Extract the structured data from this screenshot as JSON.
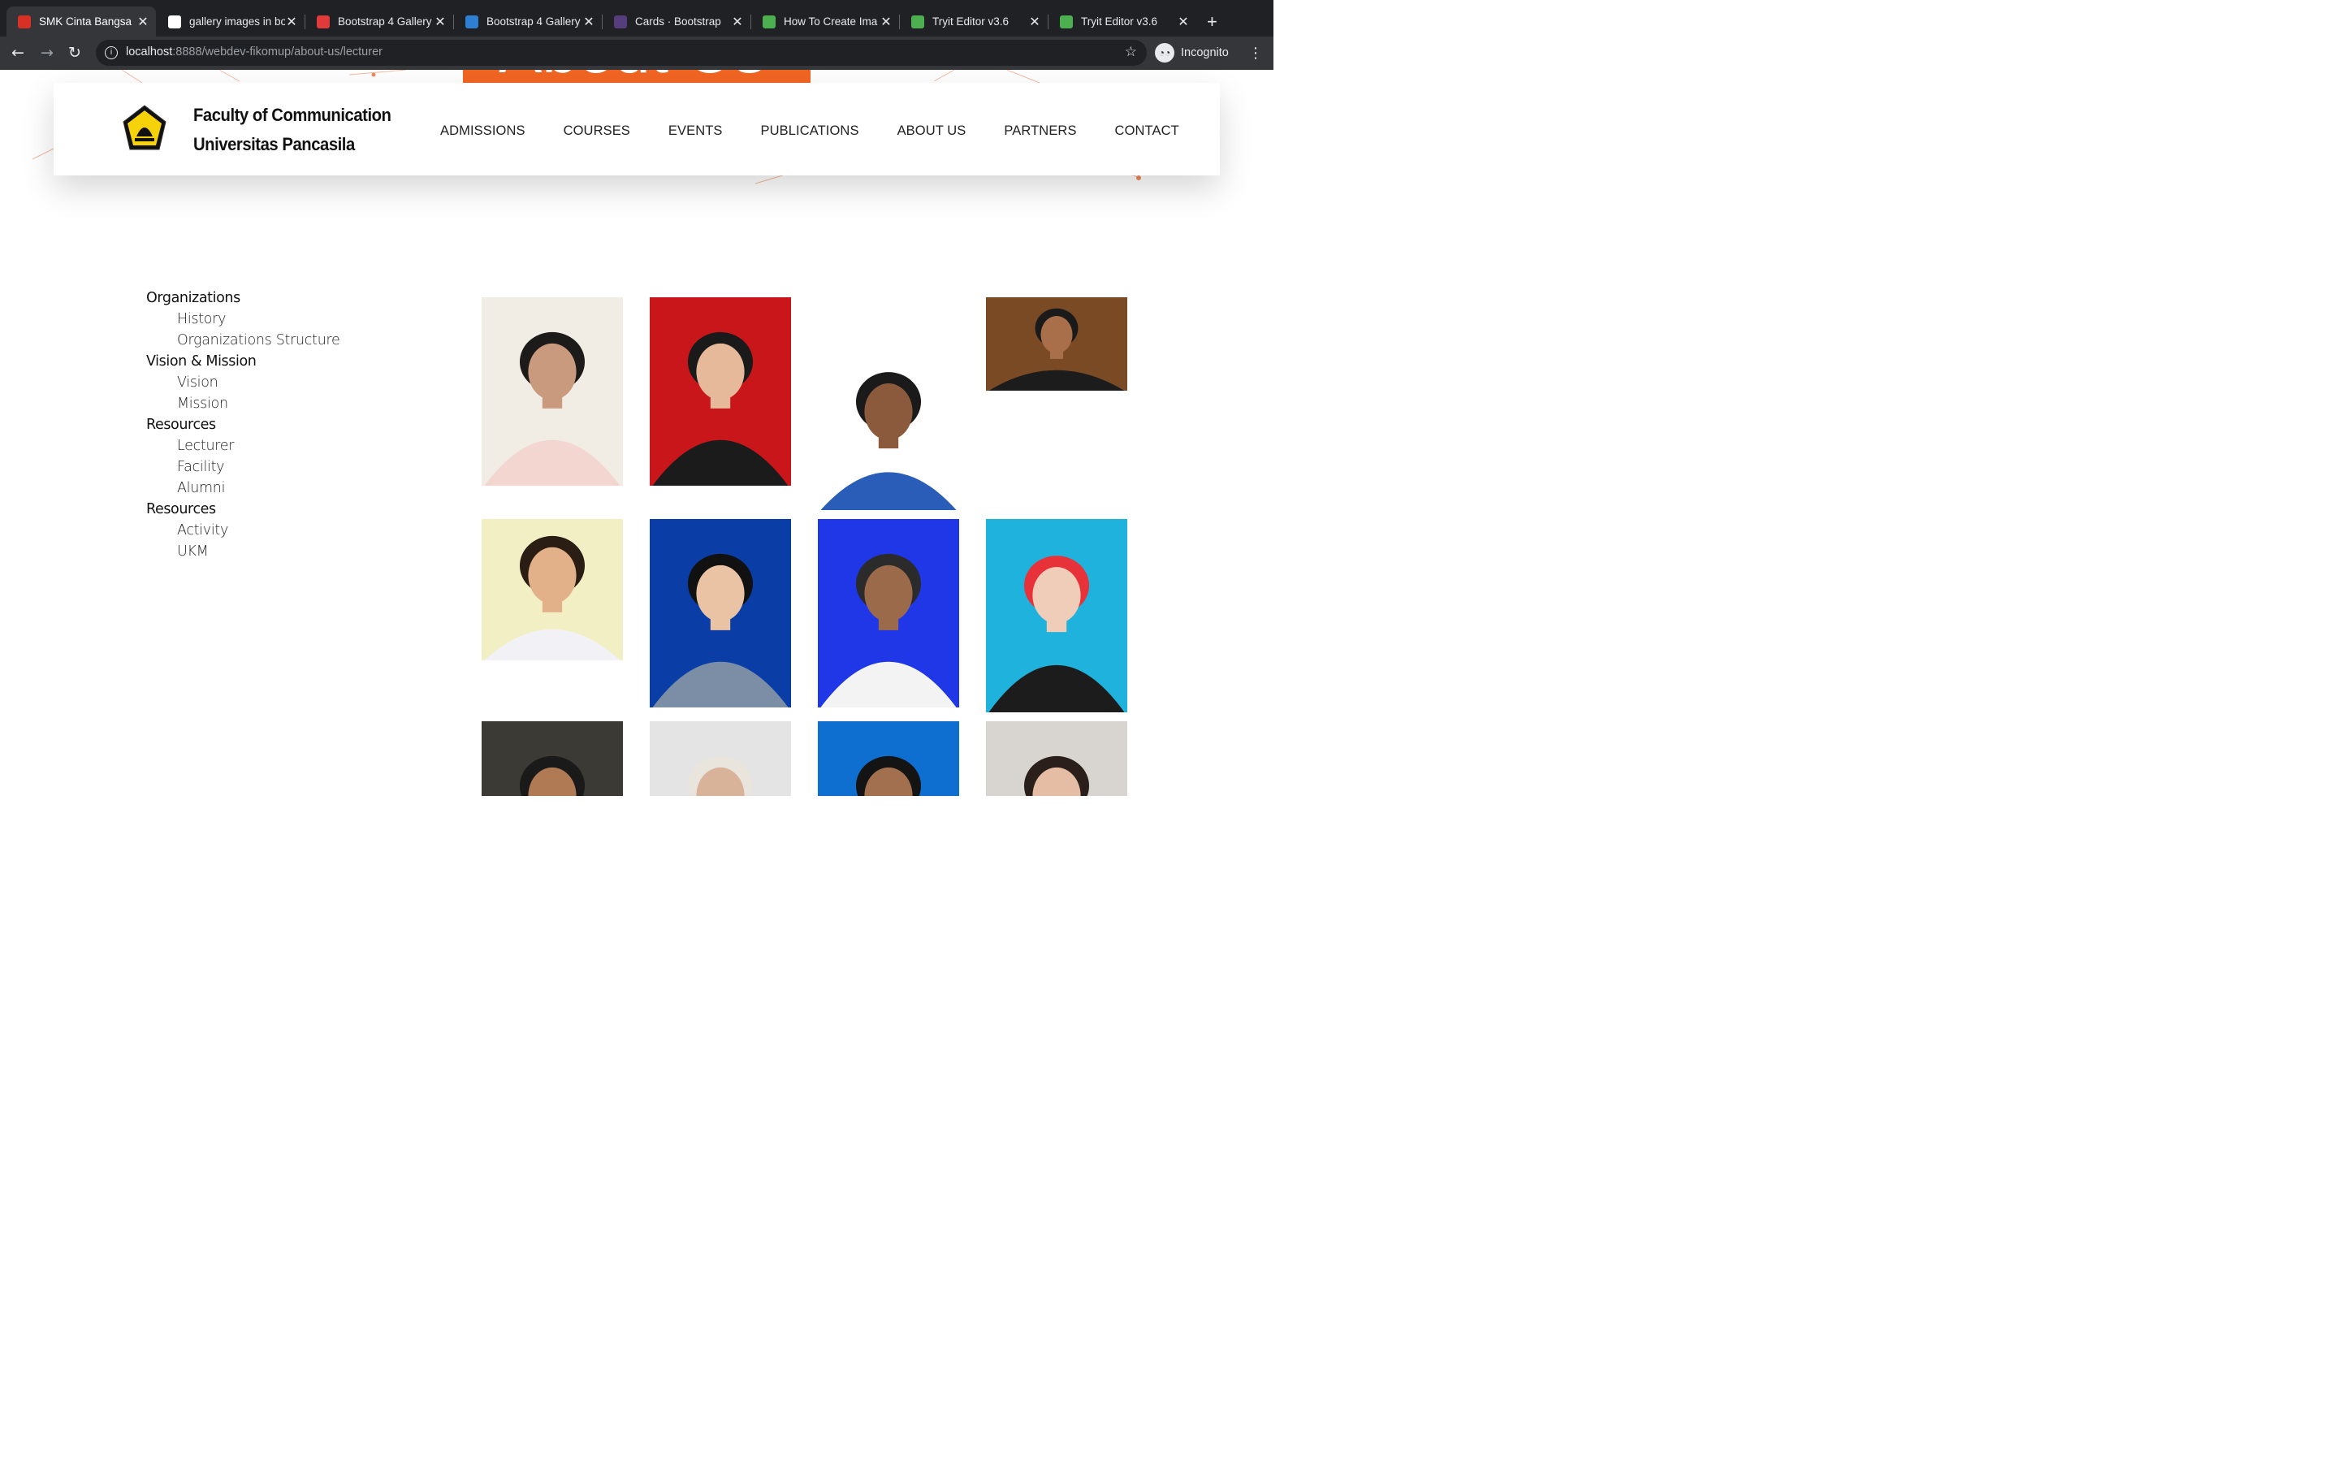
{
  "browser": {
    "tabs": [
      {
        "title": "SMK Cinta Bangsa",
        "favicon": "flag-favicon",
        "color": "#d93025",
        "active": true
      },
      {
        "title": "gallery images in bo",
        "favicon": "google-favicon",
        "color": "#ffffff",
        "active": false
      },
      {
        "title": "Bootstrap 4 Gallery",
        "favicon": "s-favicon",
        "color": "#e03a3a",
        "active": false
      },
      {
        "title": "Bootstrap 4 Gallery",
        "favicon": "code-favicon",
        "color": "#2d7fd3",
        "active": false
      },
      {
        "title": "Cards · Bootstrap",
        "favicon": "bootstrap-favicon",
        "color": "#563d7c",
        "active": false
      },
      {
        "title": "How To Create Ima",
        "favicon": "w3-favicon",
        "color": "#4caf50",
        "active": false
      },
      {
        "title": "Tryit Editor v3.6",
        "favicon": "w3-favicon",
        "color": "#4caf50",
        "active": false
      },
      {
        "title": "Tryit Editor v3.6",
        "favicon": "w3-favicon",
        "color": "#4caf50",
        "active": false
      }
    ],
    "url_host": "localhost",
    "url_rest": ":8888/webdev-fikomup/about-us/lecturer",
    "incognito_label": "Incognito"
  },
  "banner": {
    "text": "About Us",
    "color": "#f26522"
  },
  "header": {
    "brand_line1": "Faculty of Communication",
    "brand_line2": "Universitas Pancasila",
    "nav": [
      "ADMISSIONS",
      "COURSES",
      "EVENTS",
      "PUBLICATIONS",
      "ABOUT US",
      "PARTNERS",
      "CONTACT"
    ]
  },
  "sidebar": {
    "groups": [
      {
        "label": "Organizations",
        "items": [
          "History",
          "Organizations Structure"
        ]
      },
      {
        "label": "Vision & Mission",
        "items": [
          "Vision",
          "Mission"
        ]
      },
      {
        "label": "Resources",
        "items": [
          "Lecturer",
          "Facility",
          "Alumni"
        ]
      },
      {
        "label": "Resources",
        "items": [
          "Activity",
          "UKM"
        ]
      }
    ]
  },
  "gallery": {
    "photos": [
      {
        "bg": "#f1ede4",
        "shirt": "#f2d6cf",
        "skin": "#c99a7e",
        "hair": "#1d1a1a"
      },
      {
        "bg": "#c8161b",
        "shirt": "#1b1b1b",
        "skin": "#e6b99a",
        "hair": "#1a1a1a"
      },
      {
        "bg": "#ffffff",
        "shirt": "#2a5db8",
        "skin": "#8b5a3c",
        "hair": "#1a1a1a"
      },
      {
        "bg": "#7a4a24",
        "shirt": "#1c1c1c",
        "skin": "#a86f4a",
        "hair": "#1a1a1a"
      },
      {
        "bg": "#f3efc4",
        "shirt": "#f2f2f6",
        "skin": "#e3b189",
        "hair": "#2a1d14"
      },
      {
        "bg": "#0a3ea6",
        "shirt": "#7b8ea5",
        "skin": "#eac2a4",
        "hair": "#111111"
      },
      {
        "bg": "#1f37e6",
        "shirt": "#f3f3f3",
        "skin": "#9a6a4a",
        "hair": "#2b2b2b"
      },
      {
        "bg": "#1fb2dc",
        "shirt": "#1c1c1c",
        "skin": "#f0cdb8",
        "hair": "#e8323a"
      },
      {
        "bg": "#3c3a34",
        "shirt": "#4a3a2a",
        "skin": "#b07a55",
        "hair": "#1a1a1a"
      },
      {
        "bg": "#e4e4e4",
        "shirt": "#d8d2c8",
        "skin": "#d8b39a",
        "hair": "#e9e4dc"
      },
      {
        "bg": "#0f6fd1",
        "shirt": "#1c2a44",
        "skin": "#a2704e",
        "hair": "#141414"
      },
      {
        "bg": "#d8d4cf",
        "shirt": "#3a2a24",
        "skin": "#e4bda4",
        "hair": "#2a1f1a"
      }
    ]
  }
}
